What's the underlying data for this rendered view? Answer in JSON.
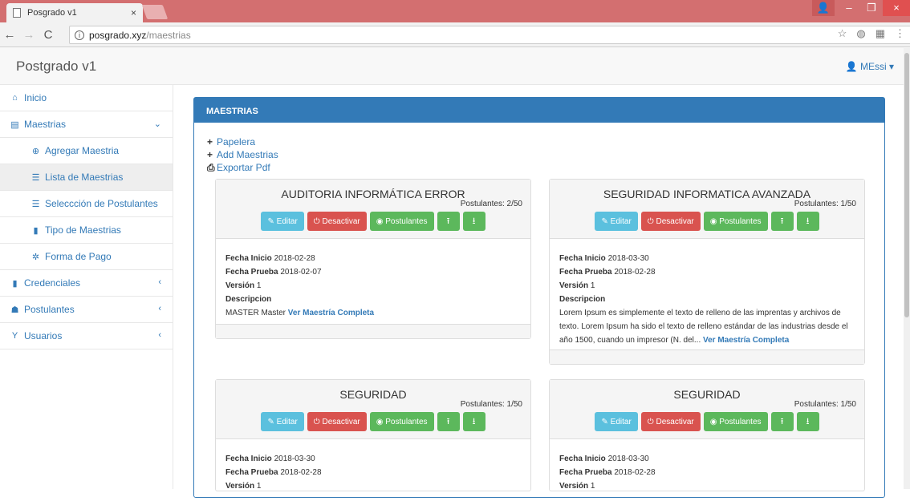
{
  "browser": {
    "tab_title": "Posgrado v1",
    "tab_close": "×",
    "url_host": "posgrado.xyz",
    "url_path": "/maestrias",
    "win_min": "–",
    "win_max": "❐",
    "win_close": "×"
  },
  "navbar": {
    "brand": "Postgrado v1",
    "user": "MEssi"
  },
  "sidebar": {
    "items": [
      {
        "label": "Inicio",
        "icon": "home-icon"
      },
      {
        "label": "Maestrias",
        "icon": "book-icon"
      },
      {
        "label": "Agregar Maestria",
        "icon": "plus-circle-icon"
      },
      {
        "label": "Lista de Maestrias",
        "icon": "list-icon"
      },
      {
        "label": "Seleccción de Postulantes",
        "icon": "list-icon"
      },
      {
        "label": "Tipo de Maestrias",
        "icon": "clipboard-icon"
      },
      {
        "label": "Forma de Pago",
        "icon": "gear-icon"
      },
      {
        "label": "Credenciales",
        "icon": "clipboard-icon"
      },
      {
        "label": "Postulantes",
        "icon": "users-icon"
      },
      {
        "label": "Usuarios",
        "icon": "trophy-icon"
      }
    ]
  },
  "panel": {
    "title": "MAESTRIAS",
    "actions": [
      "Papelera",
      "Add Maestrias",
      "Exportar Pdf"
    ]
  },
  "buttons": {
    "edit": "Editar",
    "deactivate": "Desactivar",
    "applicants": "Postulantes"
  },
  "labels": {
    "start": "Fecha Inicio",
    "test": "Fecha Prueba",
    "version": "Versión",
    "desc": "Descripcion",
    "more": "Ver Maestría Completa"
  },
  "cards": [
    {
      "title": "AUDITORIA INFORMÁTICA ERROR",
      "postulantes": "Postulantes: 2/50",
      "fecha_inicio": "2018-02-28",
      "fecha_prueba": "2018-02-07",
      "version": "1",
      "descripcion": "MASTER Master"
    },
    {
      "title": "SEGURIDAD INFORMATICA AVANZADA",
      "postulantes": "Postulantes: 1/50",
      "fecha_inicio": "2018-03-30",
      "fecha_prueba": "2018-02-28",
      "version": "1",
      "descripcion": "Lorem Ipsum es simplemente el texto de relleno de las imprentas y archivos de texto. Lorem Ipsum ha sido el texto de relleno estándar de las industrias desde el año 1500, cuando un impresor (N. del..."
    },
    {
      "title": "SEGURIDAD",
      "postulantes": "Postulantes: 1/50",
      "fecha_inicio": "2018-03-30",
      "fecha_prueba": "2018-02-28",
      "version": "1",
      "descripcion": ""
    },
    {
      "title": "SEGURIDAD",
      "postulantes": "Postulantes: 1/50",
      "fecha_inicio": "2018-03-30",
      "fecha_prueba": "2018-02-28",
      "version": "1",
      "descripcion": ""
    }
  ]
}
